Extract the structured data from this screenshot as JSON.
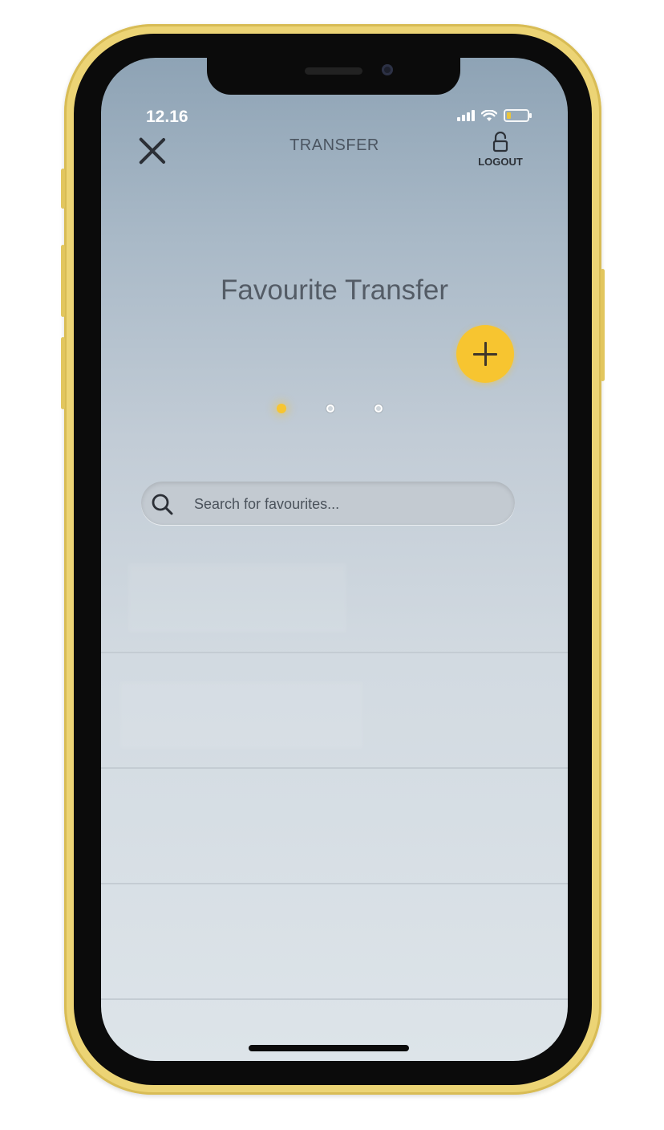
{
  "status_bar": {
    "time": "12.16",
    "signal_icon": "cellular-signal-icon",
    "wifi_icon": "wifi-icon",
    "battery_icon": "battery-low-icon",
    "battery_level": 0.2
  },
  "header": {
    "close_icon": "close-icon",
    "title": "TRANSFER",
    "logout": {
      "icon": "unlock-icon",
      "label": "LOGOUT"
    }
  },
  "main": {
    "heading": "Favourite Transfer",
    "add_button": {
      "icon": "plus-icon"
    },
    "pager": {
      "count": 3,
      "active_index": 0
    },
    "search": {
      "icon": "search-icon",
      "placeholder": "Search for favourites...",
      "value": ""
    },
    "list_item_count": 4
  },
  "colors": {
    "accent": "#f7c530",
    "text_primary": "#2b2f36",
    "heading": "#545c66",
    "phone_frame": "#ecd475"
  }
}
